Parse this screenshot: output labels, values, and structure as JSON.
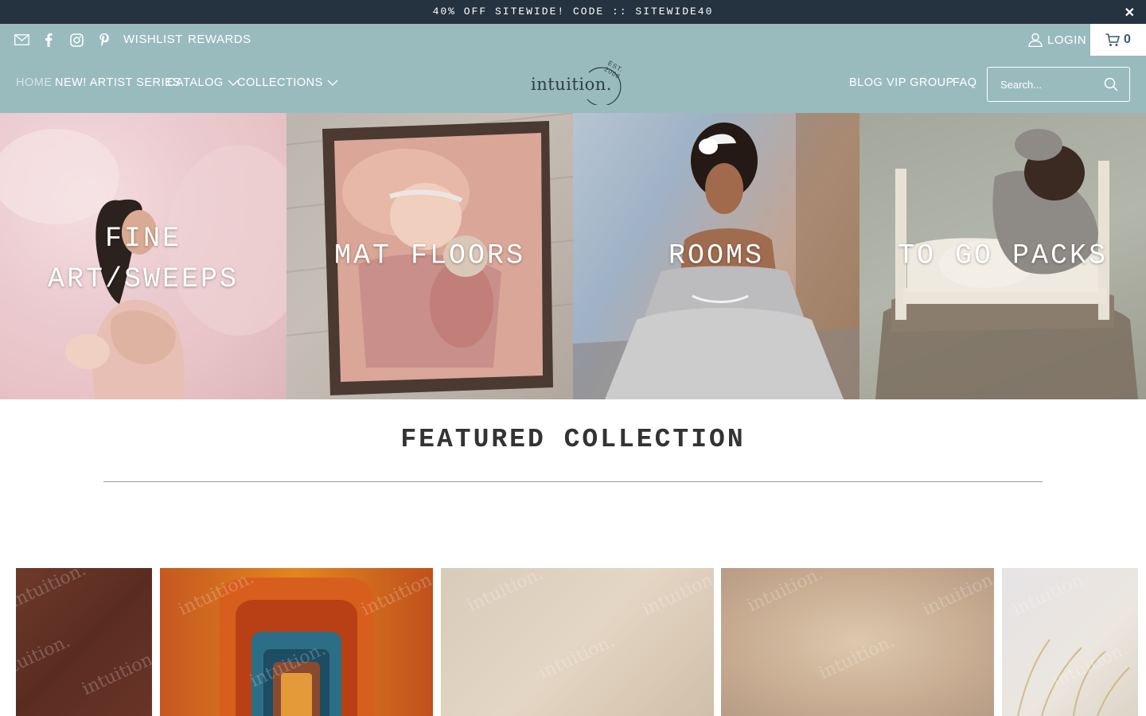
{
  "announcement": {
    "text": "40% OFF SITEWIDE! CODE :: SITEWIDE40",
    "close_glyph": "✕"
  },
  "topbar": {
    "social_icons": [
      "mail-icon",
      "facebook-icon",
      "instagram-icon",
      "pinterest-icon"
    ],
    "links": {
      "wishlist": "WISHLIST",
      "rewards": "REWARDS"
    },
    "login": "LOGIN",
    "cart_count": "0"
  },
  "nav": {
    "items": [
      {
        "label": "HOME",
        "active": true
      },
      {
        "label": "NEW! ARTIST SERIES"
      },
      {
        "label": "CATALOG",
        "dropdown": true
      },
      {
        "label": "COLLECTIONS",
        "dropdown": true
      }
    ],
    "right_items": [
      {
        "label": "BLOG"
      },
      {
        "label": "VIP GROUP"
      },
      {
        "label": "FAQ"
      }
    ],
    "logo": {
      "word": "intuition.",
      "est": "EST. 2008"
    },
    "search": {
      "placeholder": "Search..."
    }
  },
  "tiles": [
    {
      "label": "FINE ART/SWEEPS"
    },
    {
      "label": "MAT FLOORS"
    },
    {
      "label": "ROOMS"
    },
    {
      "label": "TO GO PACKS"
    }
  ],
  "featured": {
    "title": "FEATURED COLLECTION",
    "watermark": "intuition."
  },
  "colors": {
    "announce_bg": "#253340",
    "header_bg": "#9abbbe",
    "text_dark": "#333333"
  }
}
